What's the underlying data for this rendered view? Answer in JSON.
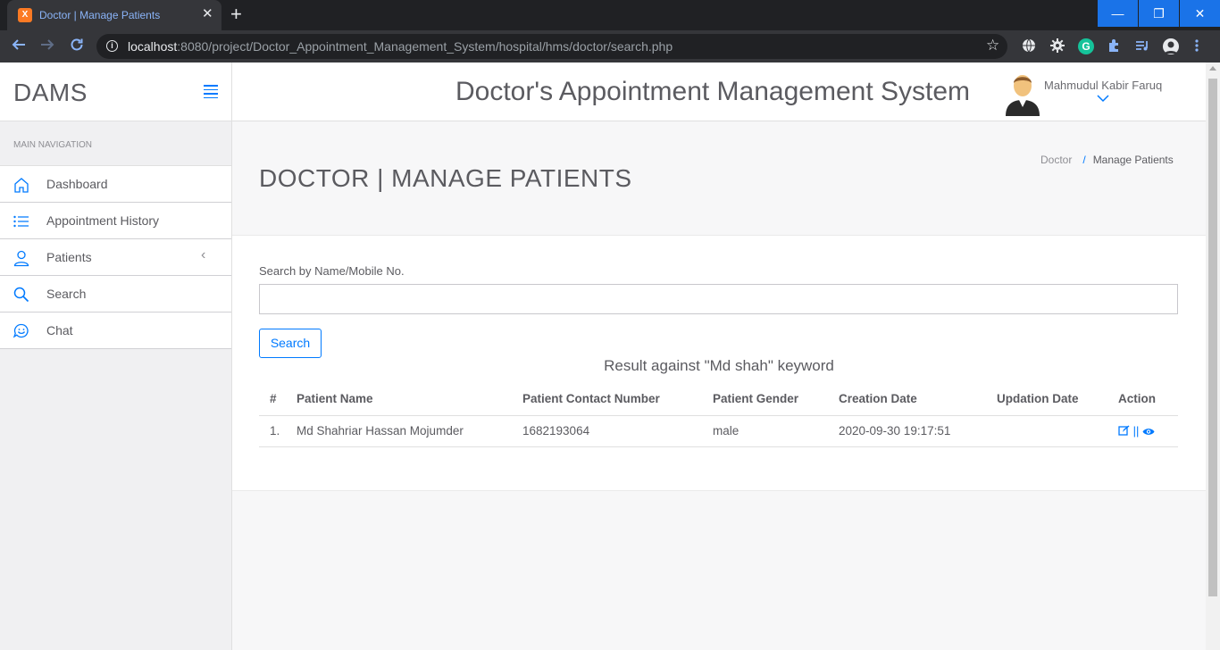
{
  "browser": {
    "tab_title": "Doctor | Manage Patients",
    "favicon_letter": "X",
    "tab_close": "✕",
    "new_tab": "+",
    "url_host": "localhost",
    "url_rest": ":8080/project/Doctor_Appointment_Management_System/hospital/hms/doctor/search.php",
    "window_controls": {
      "minimize": "—",
      "maximize": "❐",
      "close": "✕"
    }
  },
  "header": {
    "brand": "DAMS",
    "system_title": "Doctor's Appointment Management System",
    "user_name": "Mahmudul Kabir Faruq",
    "user_caret": "⌄"
  },
  "sidebar": {
    "heading": "MAIN NAVIGATION",
    "items": [
      {
        "label": "Dashboard",
        "icon": "home-icon"
      },
      {
        "label": "Appointment History",
        "icon": "list-icon"
      },
      {
        "label": "Patients",
        "icon": "user-icon",
        "chevron": "‹"
      },
      {
        "label": "Search",
        "icon": "search-icon"
      },
      {
        "label": "Chat",
        "icon": "chat-icon"
      }
    ]
  },
  "page": {
    "title": "DOCTOR | MANAGE PATIENTS",
    "breadcrumb": {
      "parent": "Doctor",
      "separator": "/",
      "current": "Manage Patients"
    }
  },
  "search": {
    "label": "Search by Name/Mobile No.",
    "value": "",
    "button_label": "Search",
    "result_heading": "Result against \"Md shah\" keyword"
  },
  "table": {
    "columns": [
      "#",
      "Patient Name",
      "Patient Contact Number",
      "Patient Gender",
      "Creation Date",
      "Updation Date",
      "Action"
    ],
    "rows": [
      {
        "num": "1.",
        "name": "Md Shahriar Hassan Mojumder",
        "phone": "1682193064",
        "gender": "male",
        "created": "2020-09-30 19:17:51",
        "updated": "",
        "action_sep": "||"
      }
    ]
  },
  "colors": {
    "accent": "#007aff",
    "chrome_dark": "#202124",
    "chrome_toolbar": "#35363a",
    "text_muted": "#5b5b60"
  }
}
